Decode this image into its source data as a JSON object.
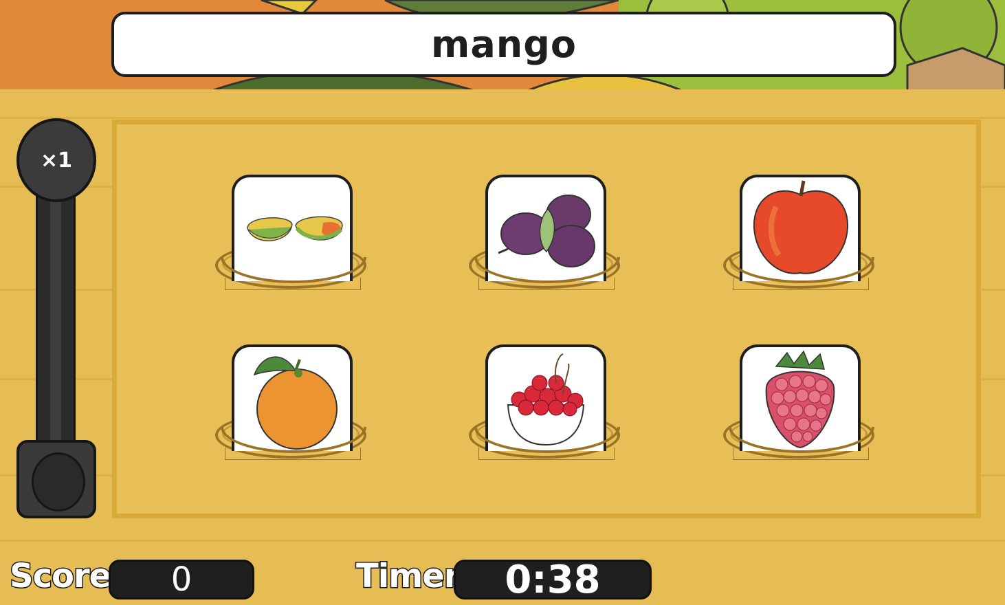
{
  "target_word": "mango",
  "multiplier": {
    "label": "×1"
  },
  "cards": [
    {
      "name": "mango-card",
      "icon": "mango-halves-icon"
    },
    {
      "name": "plums-card",
      "icon": "plums-icon"
    },
    {
      "name": "apple-card",
      "icon": "apple-icon"
    },
    {
      "name": "orange-card",
      "icon": "orange-icon"
    },
    {
      "name": "cherries-card",
      "icon": "cherries-bowl-icon"
    },
    {
      "name": "raspberry-card",
      "icon": "raspberry-icon"
    }
  ],
  "hud": {
    "score_label": "Score",
    "score_value": "0",
    "timer_label": "Timer",
    "timer_value": "0:38"
  },
  "colors": {
    "wood": "#e6bd54",
    "board_border": "#d9a93a",
    "dark": "#1e1e1e",
    "backdrop_orange": "#e2883a",
    "backdrop_green": "#8fb23a"
  }
}
